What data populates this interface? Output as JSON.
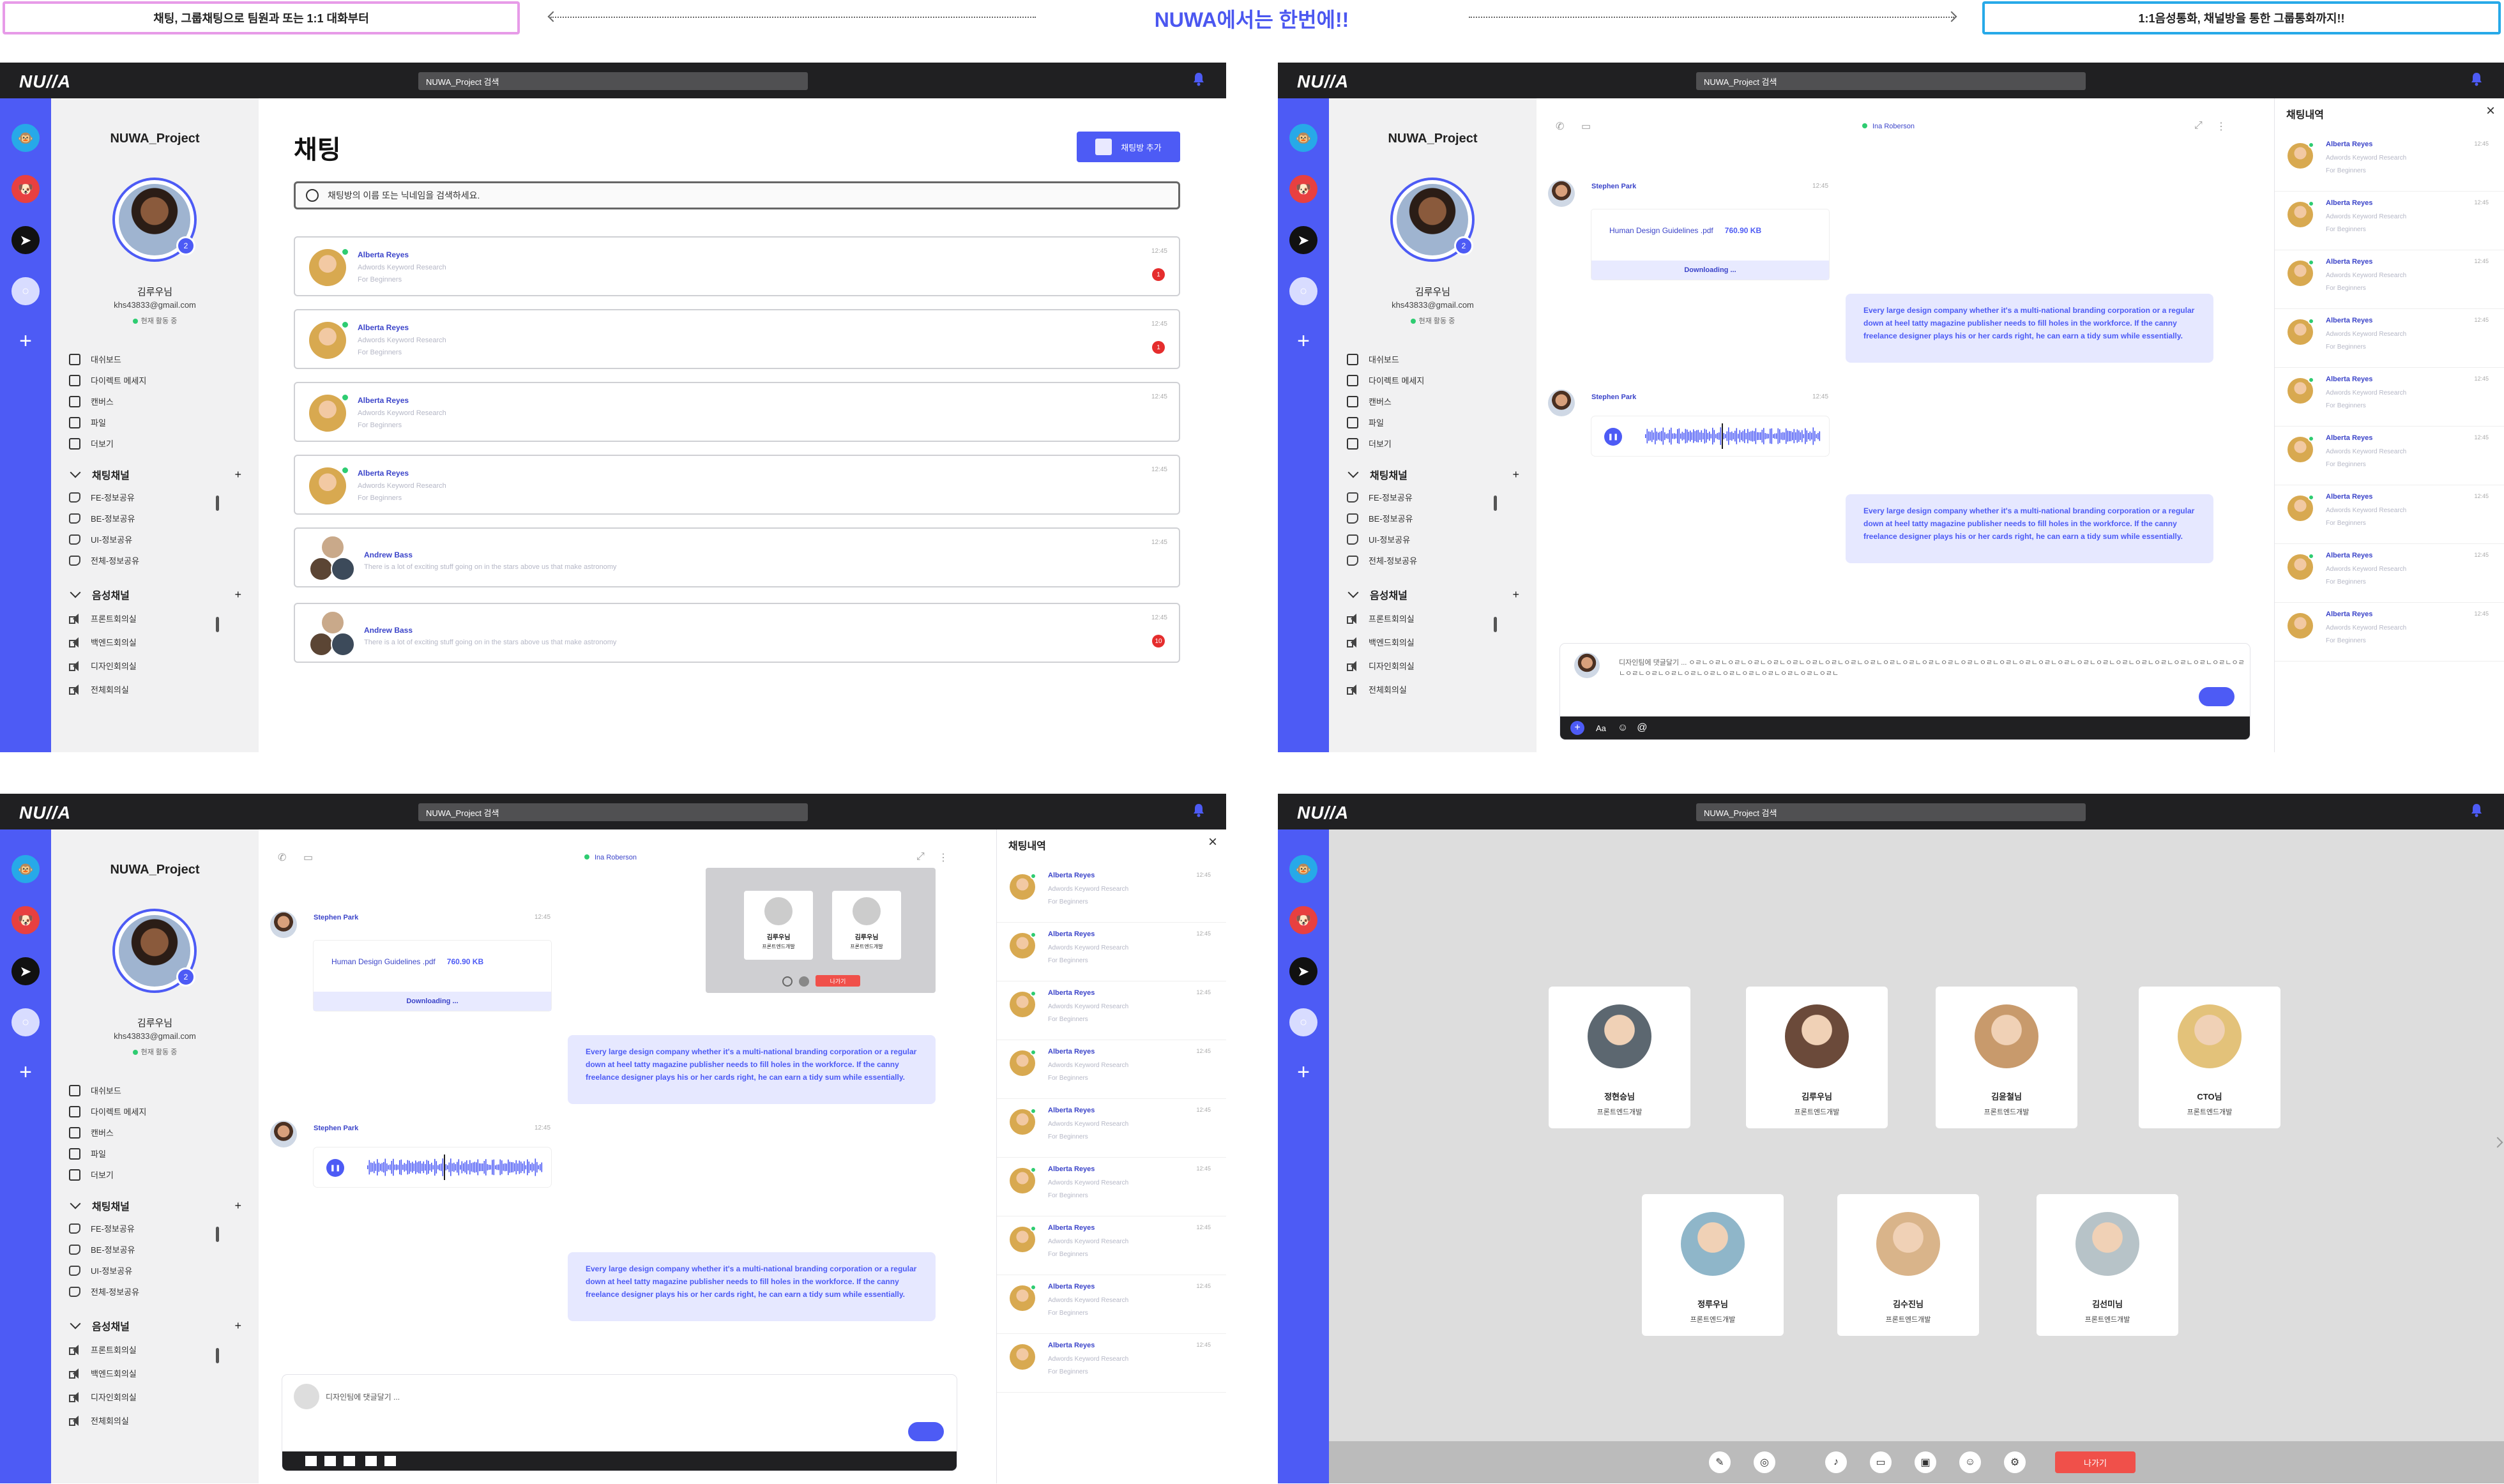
{
  "banner": {
    "left": "채팅, 그룹채팅으로 팀원과 또는 1:1 대화부터",
    "center": "NUWA에서는 한번에!!",
    "right": "1:1음성통화, 채널방을 통한 그룹통화까지!!"
  },
  "app": {
    "logo": "NU//A",
    "search_placeholder": "NUWA_Project 검색",
    "project": "NUWA_Project",
    "user_name": "김루우님",
    "user_email": "khs43833@gmail.com",
    "user_status": "현재 활동 중",
    "avatar_badge": "2",
    "menu": [
      "대쉬보드",
      "다이렉트 메세지",
      "캔버스",
      "파일",
      "더보기"
    ],
    "chat_channels_title": "채팅채널",
    "chat_channels": [
      "FE-정보공유",
      "BE-정보공유",
      "UI-정보공유",
      "전체-정보공유"
    ],
    "voice_channels_title": "음성채널",
    "voice_channels": [
      "프론트회의실",
      "백엔드회의실",
      "디자인회의실",
      "전체회의실"
    ]
  },
  "chat_list": {
    "title": "채팅",
    "add_button": "채팅방 추가",
    "search_placeholder": "채팅방의 이름 또는 닉네임을 검색하세요.",
    "items": [
      {
        "name": "Alberta Reyes",
        "line1": "Adwords Keyword Research",
        "line2": "For Beginners",
        "time": "12:45",
        "unread": "1"
      },
      {
        "name": "Alberta Reyes",
        "line1": "Adwords Keyword Research",
        "line2": "For Beginners",
        "time": "12:45",
        "unread": "1"
      },
      {
        "name": "Alberta Reyes",
        "line1": "Adwords Keyword Research",
        "line2": "For Beginners",
        "time": "12:45",
        "unread": ""
      },
      {
        "name": "Alberta Reyes",
        "line1": "Adwords Keyword Research",
        "line2": "For Beginners",
        "time": "12:45",
        "unread": ""
      },
      {
        "name": "Andrew Bass",
        "line1": "There is a lot of exciting stuff going on in the stars above us that make astronomy",
        "line2": "",
        "time": "12:45",
        "unread": ""
      },
      {
        "name": "Andrew Bass",
        "line1": "There is a lot of exciting stuff going on in the stars above us that make astronomy",
        "line2": "",
        "time": "12:45",
        "unread": "10"
      }
    ]
  },
  "conversation": {
    "peer": "Ina Roberson",
    "sender": "Stephen Park",
    "time": "12:45",
    "file_name": "Human Design Guidelines .pdf",
    "file_size": "760.90 KB",
    "downloading": "Downloading ...",
    "bubble_text": "Every large design company whether it's a multi-national branding corporation or a regular down at heel tatty magazine publisher needs to fill holes in the workforce. If the canny freelance designer plays his or her cards right, he can earn a tidy sum while essentially.",
    "composer_text": "디자인팀에 댓글달기 ... ㅇㄹㄴㅇㄹㄴㅇㄹㄴㅇㄹㄴㅇㄹㄴㅇㄹㄴㅇㄹㄴㅇㄹㄴㅇㄹㄴㅇㄹㄴㅇㄹㄴㅇㄹㄴㅇㄹㄴㅇㄹㄴㅇㄹㄴㅇㄹㄴㅇㄹㄴㅇㄹㄴㅇㄹㄴㅇㄹㄴㅇㄹㄴㅇㄹㄴㅇㄹㄴㅇㄹㄴㅇㄹㄴㅇㄹㄴㅇㄹㄴㅇㄹㄴㅇㄹㄴㅇㄹㄴㅇㄹㄴㅇㄹㄴㅇㄹㄴㅇㄹㄴㅇㄹㄴㅇㄹㄴㅇㄹㄴㅇㄹㄴㅇㄹㄴㅇㄹㄴ",
    "composer_placeholder": "디자인팀에 댓글달기 ...",
    "format_label": "Aa",
    "call_card": [
      {
        "name": "김루우님",
        "role": "프론트엔드개발"
      },
      {
        "name": "김루우님",
        "role": "프론트엔드개발"
      }
    ],
    "call_end": "나가기"
  },
  "history": {
    "title": "채팅내역",
    "rows": [
      {
        "name": "Alberta Reyes",
        "line1": "Adwords Keyword Research",
        "line2": "For Beginners",
        "time": "12:45"
      }
    ]
  },
  "call": {
    "leave": "나가기",
    "participants": [
      {
        "name": "정현승님",
        "role": "프론트엔드개발",
        "color": "#5c6770"
      },
      {
        "name": "김루우님",
        "role": "프론트엔드개발",
        "color": "#6b4a3a"
      },
      {
        "name": "김윤철님",
        "role": "프론트엔드개발",
        "color": "#c89a6c"
      },
      {
        "name": "CTO님",
        "role": "프론트엔드개발",
        "color": "#e3c27a"
      },
      {
        "name": "정루우님",
        "role": "프론트엔드개발",
        "color": "#8fb6c9"
      },
      {
        "name": "김수진님",
        "role": "프론트엔드개발",
        "color": "#d9b48a"
      },
      {
        "name": "김선미님",
        "role": "프론트엔드개발",
        "color": "#b7c3c8"
      }
    ]
  },
  "colors": {
    "accent": "#4d5bf5",
    "topbar": "#202022",
    "sidebar": "#f1f1f2",
    "danger": "#e52d2d"
  }
}
